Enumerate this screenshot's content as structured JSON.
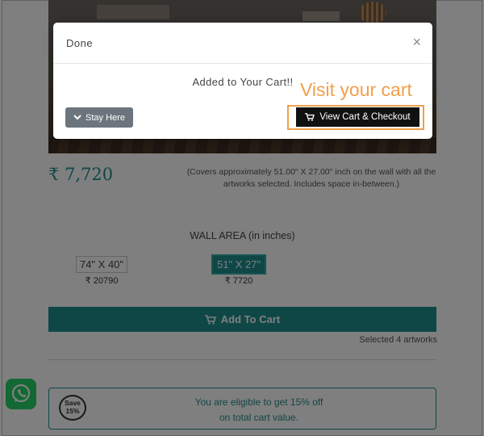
{
  "product": {
    "price": "₹ 7,720",
    "cover_note": "(Covers approximately 51.00\" X 27.00\" inch on the wall with all the artworks selected. Includes space in-between.)"
  },
  "wall_area": {
    "label": "WALL AREA (in inches)",
    "options": [
      {
        "size": "74\" X 40\"",
        "price": "₹ 20790",
        "selected": false
      },
      {
        "size": "51\" X 27\"",
        "price": "₹ 7720",
        "selected": true
      }
    ]
  },
  "cart": {
    "add_label": "Add To Cart",
    "selected_note": "Selected 4 artworks"
  },
  "promo": {
    "badge_line1": "Save",
    "badge_line2": "15%",
    "line1": "You are eligible to get 15% off",
    "line2": "on total cart value."
  },
  "modal": {
    "title": "Done",
    "close": "×",
    "message": "Added to Your Cart!!",
    "stay_label": "Stay Here",
    "view_label": "View Cart & Checkout"
  },
  "annotation": {
    "text": "Visit your cart",
    "color": "#f0a04b"
  },
  "colors": {
    "accent": "#1f8f8f",
    "whatsapp": "#25d366"
  },
  "icons": [
    "chevron-down-icon",
    "cart-icon",
    "whatsapp-icon",
    "close-icon"
  ]
}
